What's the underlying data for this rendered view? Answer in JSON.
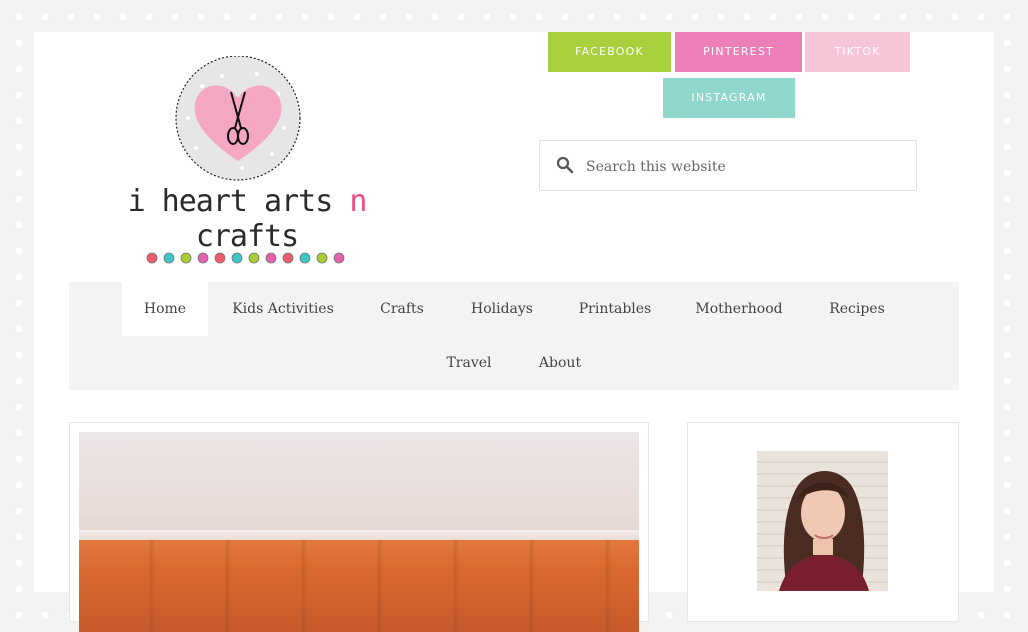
{
  "logo": {
    "title_part1": "i heart arts ",
    "title_n": "n",
    "title_part2": " crafts",
    "dot_colors": [
      "#ec5b6e",
      "#3cc5c5",
      "#a8cc34",
      "#e45fae",
      "#ec5b6e",
      "#3cc5c5",
      "#a8cc34",
      "#e45fae",
      "#ec5b6e",
      "#3cc5c5",
      "#a8cc34",
      "#e45fae"
    ],
    "heart_color": "#f5a6c2",
    "icon": "scissors-icon"
  },
  "social": [
    {
      "label": "FACEBOOK",
      "color": "#a8cf3c"
    },
    {
      "label": "PINTEREST",
      "color": "#ec7fb8"
    },
    {
      "label": "TIKTOK",
      "color": "#f6c6d8"
    },
    {
      "label": "INSTAGRAM",
      "color": "#8fd6cc"
    }
  ],
  "search": {
    "placeholder": "Search this website",
    "value": ""
  },
  "nav": {
    "items": [
      {
        "label": "Home"
      },
      {
        "label": "Kids Activities"
      },
      {
        "label": "Crafts"
      },
      {
        "label": "Holidays"
      },
      {
        "label": "Printables"
      },
      {
        "label": "Motherhood"
      },
      {
        "label": "Recipes"
      },
      {
        "label": "Travel"
      },
      {
        "label": "About"
      }
    ],
    "active": "Home"
  },
  "colors": {
    "background": "#f3f3f3",
    "nav_bg": "#f3f3f3",
    "text": "#444444"
  }
}
